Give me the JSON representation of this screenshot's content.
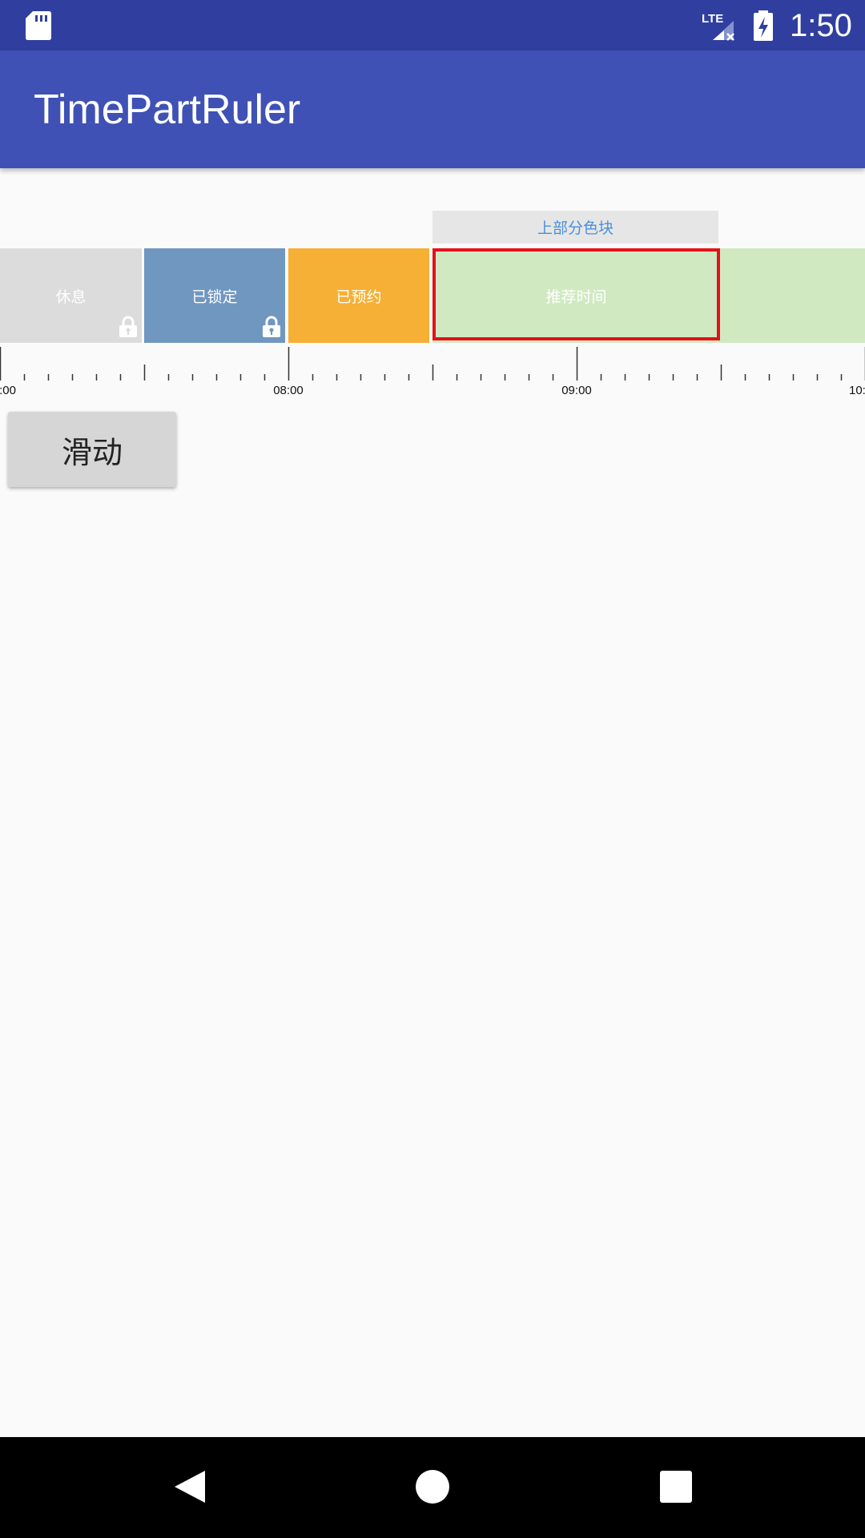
{
  "status_bar": {
    "time": "1:50",
    "icons": [
      "sd-card-icon",
      "lte-signal-icon",
      "battery-charging-icon"
    ],
    "network_label": "LTE"
  },
  "app_bar": {
    "title": "TimePartRuler"
  },
  "timeline": {
    "top_block_label": "上部分色块",
    "blocks": [
      {
        "label": "休息",
        "color": "#dcdcdc",
        "locked": true
      },
      {
        "label": "已锁定",
        "color": "#7097bf",
        "locked": true
      },
      {
        "label": "已预约",
        "color": "#f6b035",
        "locked": false
      },
      {
        "label": "推荐时间",
        "color": "#d0e9c0",
        "locked": false,
        "selected": true
      }
    ],
    "selection_color": "#e3111a",
    "ruler_labels": [
      ":00",
      "08:00",
      "09:00",
      "10:"
    ]
  },
  "actions": {
    "slide_button_label": "滑动"
  },
  "navigation": {
    "icons": [
      "back-icon",
      "home-icon",
      "recents-icon"
    ]
  },
  "colors": {
    "status_bar": "#303f9f",
    "app_bar": "#3f51b5",
    "background": "#fafafa"
  }
}
